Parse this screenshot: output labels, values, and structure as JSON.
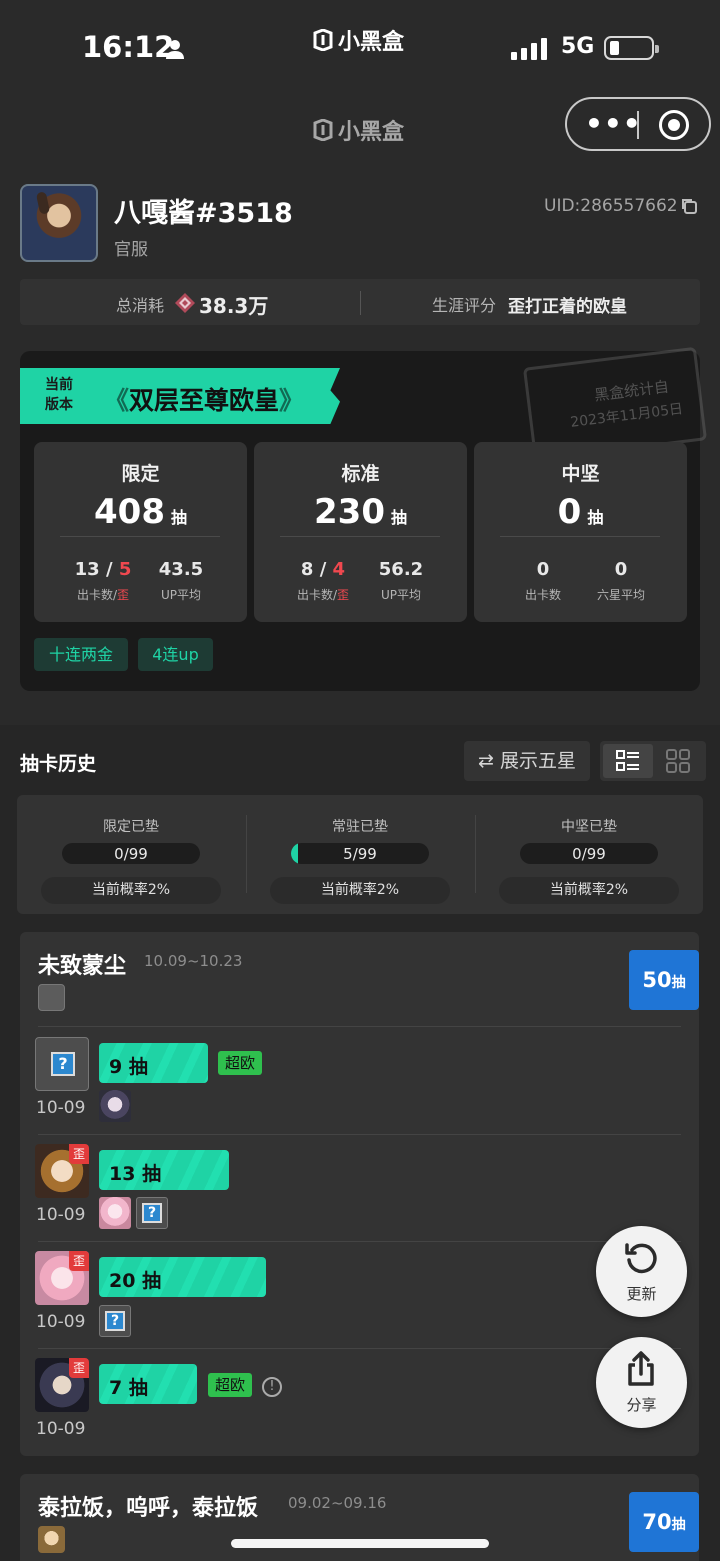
{
  "status_bar": {
    "time": "16:12",
    "app_name": "小黑盒",
    "network": "5G"
  },
  "nav": {
    "title": "小黑盒",
    "more_icon": "more-dots-icon",
    "close_icon": "target-icon"
  },
  "profile": {
    "name": "八嘎酱#3518",
    "server": "官服",
    "uid": "UID:286557662"
  },
  "summary": {
    "total_label": "总消耗",
    "total_value": "38.3万",
    "career_label": "生涯评分",
    "career_value": "歪打正着的欧皇"
  },
  "version_card": {
    "banner_small": "当前版本",
    "banner_title": "双层至尊欧皇",
    "stamp_line1": "黑盒统计自",
    "stamp_line2": "2023年11月05日",
    "pull_unit": "抽",
    "boxes": [
      {
        "title": "限定",
        "pulls": "408",
        "left_a": "13",
        "left_b": "5",
        "left_label_a": "出卡数",
        "left_label_b": "歪",
        "right_val": "43.5",
        "right_label": "UP平均"
      },
      {
        "title": "标准",
        "pulls": "230",
        "left_a": "8",
        "left_b": "4",
        "left_label_a": "出卡数",
        "left_label_b": "歪",
        "right_val": "56.2",
        "right_label": "UP平均"
      },
      {
        "title": "中坚",
        "pulls": "0",
        "left_val": "0",
        "left_label": "出卡数",
        "right_val": "0",
        "right_label": "六星平均"
      }
    ],
    "tags": [
      "十连两金",
      "4连up"
    ]
  },
  "history": {
    "title": "抽卡历史",
    "show_five_label": "展示五星",
    "pity": [
      {
        "label": "限定已垫",
        "value": "0/99",
        "fraction": 0.0,
        "rate": "当前概率2%"
      },
      {
        "label": "常驻已垫",
        "value": "5/99",
        "fraction": 0.05,
        "rate": "当前概率2%"
      },
      {
        "label": "中坚已垫",
        "value": "0/99",
        "fraction": 0.0,
        "rate": "当前概率2%"
      }
    ],
    "pools": [
      {
        "name": "未致蒙尘",
        "date": "10.09~10.23",
        "count": "50",
        "count_unit": "抽",
        "rows": [
          {
            "pulls": "9",
            "unit": "抽",
            "badge": "超欧",
            "date": "10-09",
            "off_label": ""
          },
          {
            "pulls": "13",
            "unit": "抽",
            "badge": "",
            "date": "10-09",
            "off_label": "歪"
          },
          {
            "pulls": "20",
            "unit": "抽",
            "badge": "",
            "date": "10-09",
            "off_label": "歪"
          },
          {
            "pulls": "7",
            "unit": "抽",
            "badge": "超欧",
            "date": "10-09",
            "off_label": "歪",
            "info": "!"
          }
        ]
      },
      {
        "name": "泰拉饭，呜呼，泰拉饭",
        "date": "09.02~09.16",
        "count": "70",
        "count_unit": "抽"
      }
    ]
  },
  "fabs": {
    "refresh_label": "更新",
    "share_label": "分享"
  },
  "colors": {
    "accent": "#1fd3a5",
    "blue": "#1f75d6",
    "red": "#f0484f",
    "green_badge": "#2fc04e"
  }
}
